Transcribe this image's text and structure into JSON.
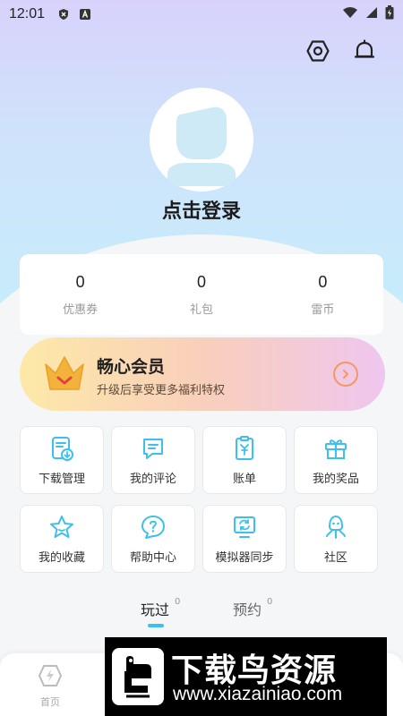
{
  "status_bar": {
    "time": "12:01"
  },
  "profile": {
    "login_label": "点击登录"
  },
  "stats": [
    {
      "value": "0",
      "label": "优惠券"
    },
    {
      "value": "0",
      "label": "礼包"
    },
    {
      "value": "0",
      "label": "雷币"
    }
  ],
  "vip": {
    "title": "畅心会员",
    "subtitle": "升级后享受更多福利特权"
  },
  "grid": [
    {
      "label": "下载管理",
      "icon": "download-manage-icon"
    },
    {
      "label": "我的评论",
      "icon": "comment-icon"
    },
    {
      "label": "账单",
      "icon": "bill-icon"
    },
    {
      "label": "我的奖品",
      "icon": "gift-icon"
    },
    {
      "label": "我的收藏",
      "icon": "star-icon"
    },
    {
      "label": "帮助中心",
      "icon": "help-icon"
    },
    {
      "label": "模拟器同步",
      "icon": "sync-icon"
    },
    {
      "label": "社区",
      "icon": "community-icon"
    }
  ],
  "tabs": {
    "played": {
      "label": "玩过",
      "count": "0"
    },
    "reserved": {
      "label": "预约",
      "count": "0"
    }
  },
  "bottom_nav": {
    "home_label": "首页"
  },
  "watermark": {
    "title": "下载鸟资源",
    "url": "www.xiazainiao.com"
  },
  "colors": {
    "accent": "#3cc0ec",
    "vip_arrow": "#f19a5e"
  }
}
